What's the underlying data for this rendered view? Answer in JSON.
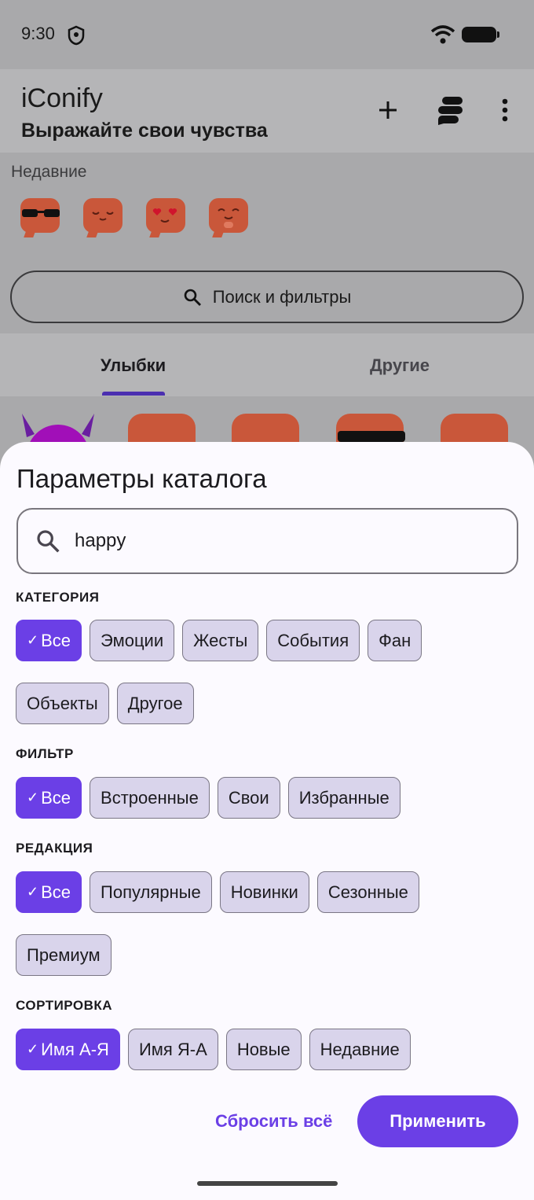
{
  "status": {
    "time": "9:30"
  },
  "app": {
    "title": "iConify",
    "subtitle": "Выражайте свои чувства",
    "actions": [
      "add-icon",
      "stack-icon",
      "more-vert-icon"
    ]
  },
  "recent": {
    "label": "Недавние"
  },
  "search_pill": {
    "label": "Поиск и фильтры"
  },
  "tabs": [
    {
      "label": "Улыбки"
    },
    {
      "label": "Другие"
    }
  ],
  "sheet": {
    "title": "Параметры каталога",
    "search": {
      "value": "happy"
    },
    "sections": [
      {
        "label": "КАТЕГОРИЯ",
        "chips": [
          "Все",
          "Эмоции",
          "Жесты",
          "События",
          "Фан",
          "Объекты",
          "Другое"
        ],
        "selected": "Все"
      },
      {
        "label": "ФИЛЬТР",
        "chips": [
          "Все",
          "Встроенные",
          "Свои",
          "Избранные"
        ],
        "selected": "Все"
      },
      {
        "label": "РЕДАКЦИЯ",
        "chips": [
          "Все",
          "Популярные",
          "Новинки",
          "Сезонные",
          "Премиум"
        ],
        "selected": "Все"
      },
      {
        "label": "СОРТИРОВКА",
        "chips": [
          "Имя А-Я",
          "Имя Я-А",
          "Новые",
          "Недавние"
        ],
        "selected": "Имя А-Я"
      }
    ],
    "reset_label": "Сбросить всё",
    "apply_label": "Применить"
  },
  "colors": {
    "accent": "#6b3fe6",
    "chip_bg": "#d9d4eb",
    "emoji": "#c9573a"
  }
}
